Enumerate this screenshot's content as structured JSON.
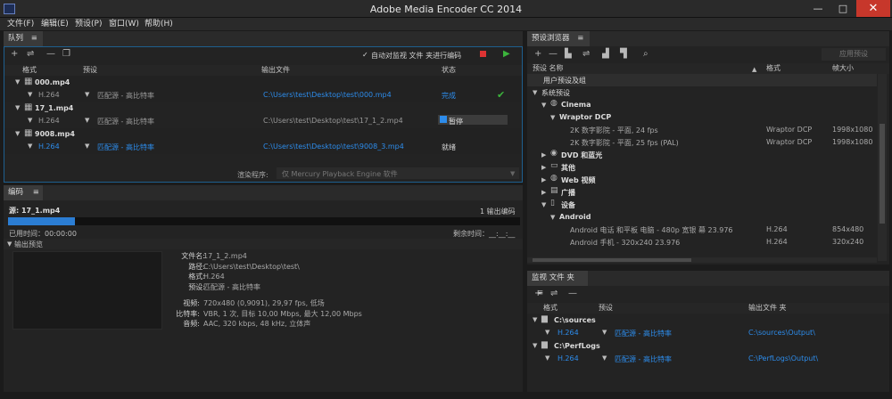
{
  "window": {
    "title": "Adobe Media Encoder CC 2014"
  },
  "menu": [
    "文件(F)",
    "编辑(E)",
    "预设(P)",
    "窗口(W)",
    "帮助(H)"
  ],
  "queue": {
    "tab": "队列",
    "auto_watch": "自动对监视 文件 夹进行编码",
    "columns": [
      "格式",
      "预设",
      "输出文件",
      "状态"
    ],
    "groups": [
      {
        "name": "000.mp4",
        "format": "H.264",
        "preset": "匹配源 - 高比特率",
        "output": "C:\\Users\\test\\Desktop\\test\\000.mp4",
        "status": "完成"
      },
      {
        "name": "17_1.mp4",
        "format": "H.264",
        "preset": "匹配源 - 高比特率",
        "output": "C:\\Users\\test\\Desktop\\test\\17_1_2.mp4",
        "status": "暂停"
      },
      {
        "name": "9008.mp4",
        "format": "H.264",
        "preset": "匹配源 - 高比特率",
        "output": "C:\\Users\\test\\Desktop\\test\\9008_3.mp4",
        "status": "就绪"
      }
    ],
    "renderer_label": "渲染程序:",
    "renderer_value": "仅 Mercury Playback Engine 软件"
  },
  "encode": {
    "tab": "编码",
    "source": "源: 17_1.mp4",
    "count": "1 输出编码",
    "elapsed": "已用时间：00:00:00",
    "remaining": "剩余时间：__:__:__",
    "progress": 0.13,
    "output_preview": "输出预览",
    "file_labels": [
      "文件名:",
      "路径:",
      "格式:",
      "预设:"
    ],
    "file_values": [
      "17_1_2.mp4",
      "C:\\Users\\test\\Desktop\\test\\",
      "H.264",
      "匹配源 - 高比特率"
    ],
    "av_labels": [
      "视频:",
      "比特率:",
      "音频:"
    ],
    "av_values": [
      "720x480 (0,9091), 29,97 fps, 低场",
      "VBR, 1 次, 目标 10,00 Mbps, 最大 12,00 Mbps",
      "AAC, 320 kbps, 48 kHz, 立体声"
    ]
  },
  "preset_browser": {
    "tab": "预设浏览器",
    "apply_button": "应用预设",
    "columns": [
      "预设 名称",
      "格式",
      "帧大小"
    ],
    "tree": [
      {
        "label": "用户预设及组",
        "bold": true
      },
      {
        "label": "系统预设",
        "bold": false
      },
      {
        "label": "Cinema",
        "bold": true
      },
      {
        "label": "Wraptor DCP",
        "bold": true
      },
      {
        "label": "2K 数字影院 - 平面, 24 fps",
        "format": "Wraptor DCP",
        "size": "1998x1080"
      },
      {
        "label": "2K 数字影院 - 平面, 25 fps (PAL)",
        "format": "Wraptor DCP",
        "size": "1998x1080"
      },
      {
        "label": "DVD 和蓝光",
        "bold": true
      },
      {
        "label": "其他",
        "bold": true
      },
      {
        "label": "Web 视频",
        "bold": true
      },
      {
        "label": "广播",
        "bold": true
      },
      {
        "label": "设备",
        "bold": true
      },
      {
        "label": "Android",
        "bold": true
      },
      {
        "label": "Android 电话 和平板 电脑 - 480p 宽银 幕 23.976",
        "format": "H.264",
        "size": "854x480"
      },
      {
        "label": "Android 手机 - 320x240 23.976",
        "format": "H.264",
        "size": "320x240"
      }
    ]
  },
  "watch": {
    "tab": "监视 文件 夹",
    "columns": [
      "格式",
      "预设",
      "输出文件 夹"
    ],
    "folders": [
      {
        "name": "C:\\sources",
        "format": "H.264",
        "preset": "匹配源 - 高比特率",
        "output": "C:\\sources\\Output\\"
      },
      {
        "name": "C:\\PerfLogs",
        "format": "H.264",
        "preset": "匹配源 - 高比特率",
        "output": "C:\\PerfLogs\\Output\\"
      }
    ]
  }
}
